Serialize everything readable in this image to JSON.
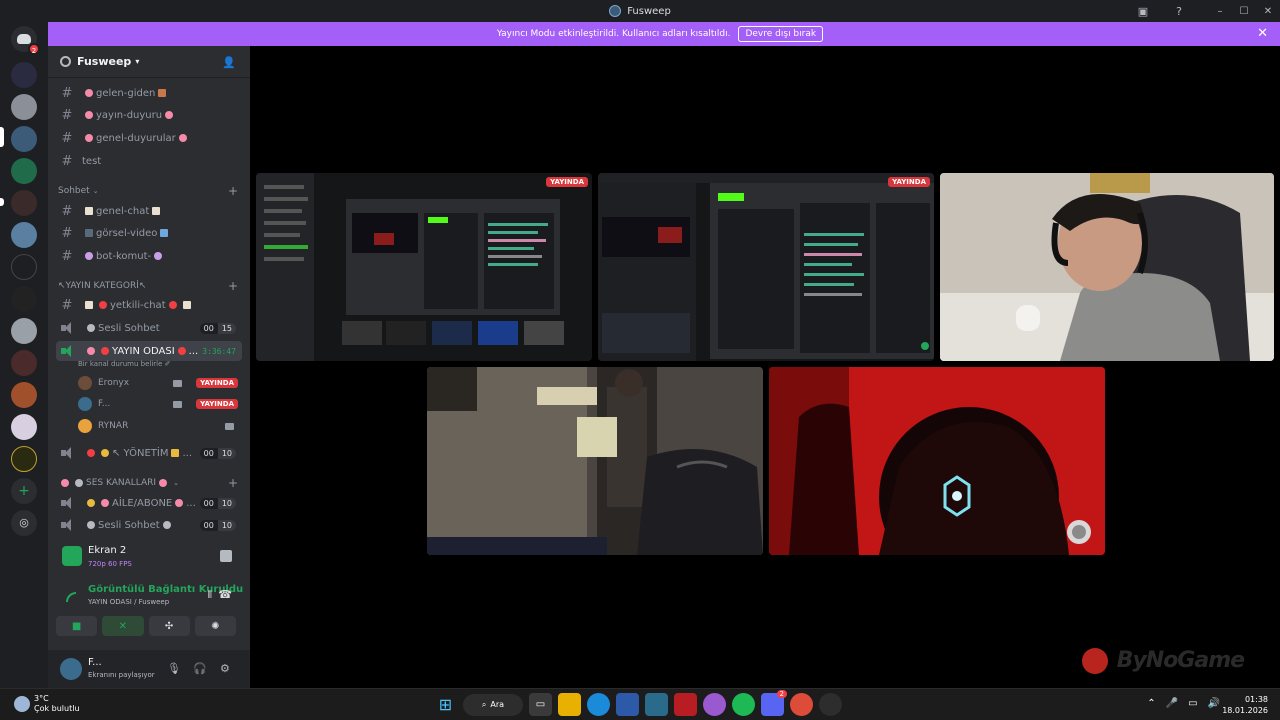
{
  "window": {
    "title": "Fusweep",
    "controls": [
      "–",
      "☐",
      "✕"
    ]
  },
  "banner": {
    "message": "Yayıncı Modu etkinleştirildi. Kullanıcı adları kısaltıldı.",
    "button": "Devre dışı bırak"
  },
  "rail": {
    "dm_badge": "2",
    "add_icon": "+",
    "explore_icon": "◎"
  },
  "server": {
    "name": "Fusweep"
  },
  "channels": {
    "top": [
      {
        "name": "gelen-giden"
      },
      {
        "name": "yayın-duyuru"
      },
      {
        "name": "genel-duyurular"
      },
      {
        "name": "test"
      }
    ],
    "sohbet_category": "Sohbet",
    "sohbet": [
      {
        "name": "genel-chat"
      },
      {
        "name": "görsel-video"
      },
      {
        "name": "bot-komut-"
      }
    ],
    "yayin_category": "↖YAYIN KATEGORİ↖",
    "yetkili": "yetkili-chat",
    "voice1": {
      "name": "Sesli Sohbet",
      "count": "00",
      "limit": "15"
    },
    "live_room": {
      "name": "YAYIN ODASI",
      "timer": "3:36:47",
      "status": "Bir kanal durumu belirle ✐"
    },
    "users": [
      {
        "name": "Eronyx",
        "live": "YAYINDA",
        "color": "#6b4d3a"
      },
      {
        "name": "F...",
        "live": "YAYINDA",
        "color": "#3b6c8e"
      },
      {
        "name": "RYNAR",
        "live": "",
        "color": "#e8a33d"
      }
    ],
    "yonetim": {
      "name": "↖ YÖNETİM ",
      "count": "00",
      "limit": "10"
    },
    "ses_category": "SES KANALLARI",
    "aile": {
      "name": "AİLE/ABONE",
      "count": "00",
      "limit": "10"
    },
    "voice2": {
      "name": "Sesli Sohbet",
      "count": "00",
      "limit": "10"
    }
  },
  "screen_panel": {
    "title": "Ekran 2",
    "quality": "720p 60 FPS"
  },
  "voice_panel": {
    "status": "Görüntülü Bağlantı Kuruldu",
    "location": "YAYIN ODASI / Fusweep"
  },
  "user_panel": {
    "name": "F...",
    "status": "Ekranını paylaşıyor"
  },
  "stage": {
    "live_label": "YAYINDA",
    "watermark": "ByNoGame"
  },
  "taskbar": {
    "temp": "3°C",
    "weather": "Çok bulutlu",
    "search": "Ara",
    "time": "01:38",
    "date": "18.01.2026",
    "discord_badge": "2"
  }
}
